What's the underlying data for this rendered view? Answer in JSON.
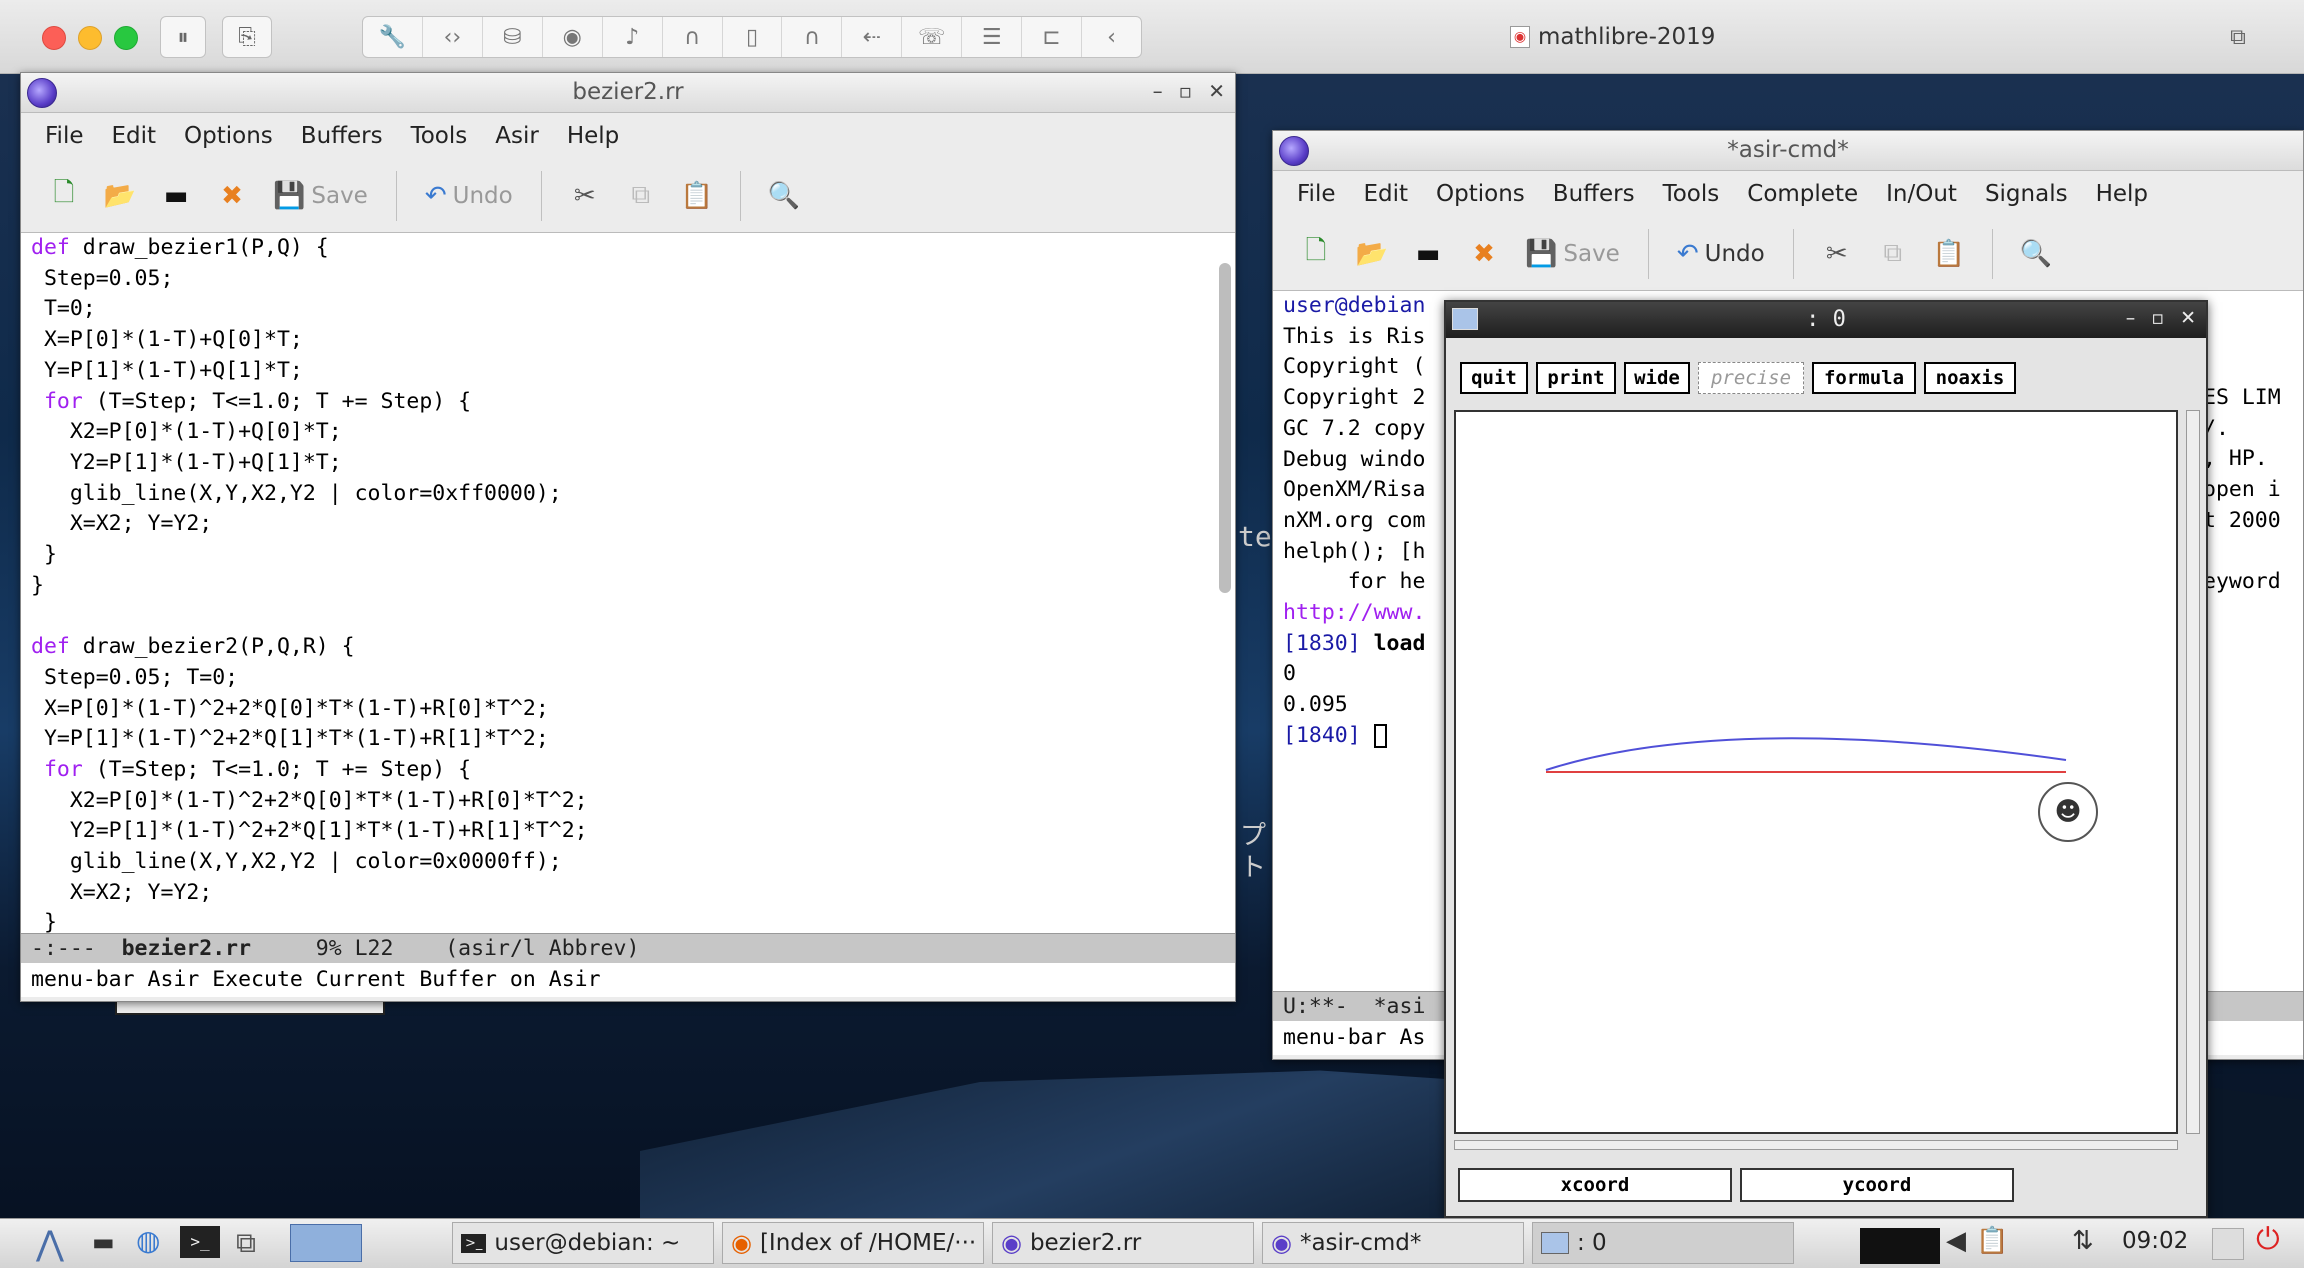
{
  "vm": {
    "title": "mathlibre-2019"
  },
  "editor": {
    "title": "bezier2.rr",
    "menu": [
      "File",
      "Edit",
      "Options",
      "Buffers",
      "Tools",
      "Asir",
      "Help"
    ],
    "toolbar": {
      "save": "Save",
      "undo": "Undo"
    },
    "lines": [
      "def draw_bezier1(P,Q) {",
      " Step=0.05;",
      " T=0;",
      " X=P[0]*(1-T)+Q[0]*T;",
      " Y=P[1]*(1-T)+Q[1]*T;",
      " for (T=Step; T<=1.0; T += Step) {",
      "   X2=P[0]*(1-T)+Q[0]*T;",
      "   Y2=P[1]*(1-T)+Q[1]*T;",
      "   glib_line(X,Y,X2,Y2 | color=0xff0000);",
      "   X=X2; Y=Y2;",
      " }",
      "}",
      "",
      "def draw_bezier2(P,Q,R) {",
      " Step=0.05; T=0;",
      " X=P[0]*(1-T)^2+2*Q[0]*T*(1-T)+R[0]*T^2;",
      " Y=P[1]*(1-T)^2+2*Q[1]*T*(1-T)+R[1]*T^2;",
      " for (T=Step; T<=1.0; T += Step) {",
      "   X2=P[0]*(1-T)^2+2*Q[0]*T*(1-T)+R[0]*T^2;",
      "   Y2=P[1]*(1-T)^2+2*Q[1]*T*(1-T)+R[1]*T^2;",
      "   glib_line(X,Y,X2,Y2 | color=0x0000ff);",
      "   X=X2; Y=Y2;",
      " }"
    ],
    "modeline": {
      "left": "-:---  ",
      "buffer": "bezier2.rr",
      "right": "     9% L22    (asir/l Abbrev)"
    },
    "echo": "menu-bar Asir Execute Current Buffer on Asir"
  },
  "asircmd": {
    "title": "*asir-cmd*",
    "menu": [
      "File",
      "Edit",
      "Options",
      "Buffers",
      "Tools",
      "Complete",
      "In/Out",
      "Signals",
      "Help"
    ],
    "toolbar": {
      "save": "Save",
      "undo": "Undo"
    },
    "lines": [
      {
        "text": "user@debian",
        "color": "#1a1aa6"
      },
      {
        "text": "This is Ris",
        "color": "#000"
      },
      {
        "text": "Copyright (",
        "color": "#000"
      },
      {
        "text": "Copyright 2",
        "color": "#000"
      },
      {
        "text": "GC 7.2 copy",
        "color": "#000"
      },
      {
        "text": "Debug windo",
        "color": "#000"
      },
      {
        "text": "OpenXM/Risa",
        "color": "#000"
      },
      {
        "text": "nXM.org com",
        "color": "#000"
      },
      {
        "text": "helph(); [h",
        "color": "#000"
      },
      {
        "text": "     for he",
        "color": "#000"
      },
      {
        "text": "http://www.",
        "color": "#a020f0"
      },
      {
        "text": "[1830] ",
        "color": "#1a1aa6",
        "extra": "load"
      },
      {
        "text": "0",
        "color": "#000"
      },
      {
        "text": "0.095",
        "color": "#000"
      },
      {
        "text": "[1840] ",
        "color": "#1a1aa6"
      }
    ],
    "right_lines": [
      "ES LIM",
      "/.",
      ", HP.",
      "open i",
      "t 2000",
      "",
      "eyword"
    ],
    "modeline": "U:**-  *asi",
    "echo": "menu-bar As"
  },
  "plot": {
    "title": ": 0",
    "buttons": {
      "quit": "quit",
      "print": "print",
      "wide": "wide",
      "precise": "precise",
      "formula": "formula",
      "noaxis": "noaxis"
    },
    "xcoord": "xcoord",
    "ycoord": "ycoord"
  },
  "desktop": {
    "partial_text": "te",
    "katakana": "プト"
  },
  "taskbar": {
    "items": [
      "user@debian: ~",
      "[Index of /HOME/···",
      "bezier2.rr",
      "*asir-cmd*",
      ": 0"
    ],
    "clock": "09:02"
  }
}
